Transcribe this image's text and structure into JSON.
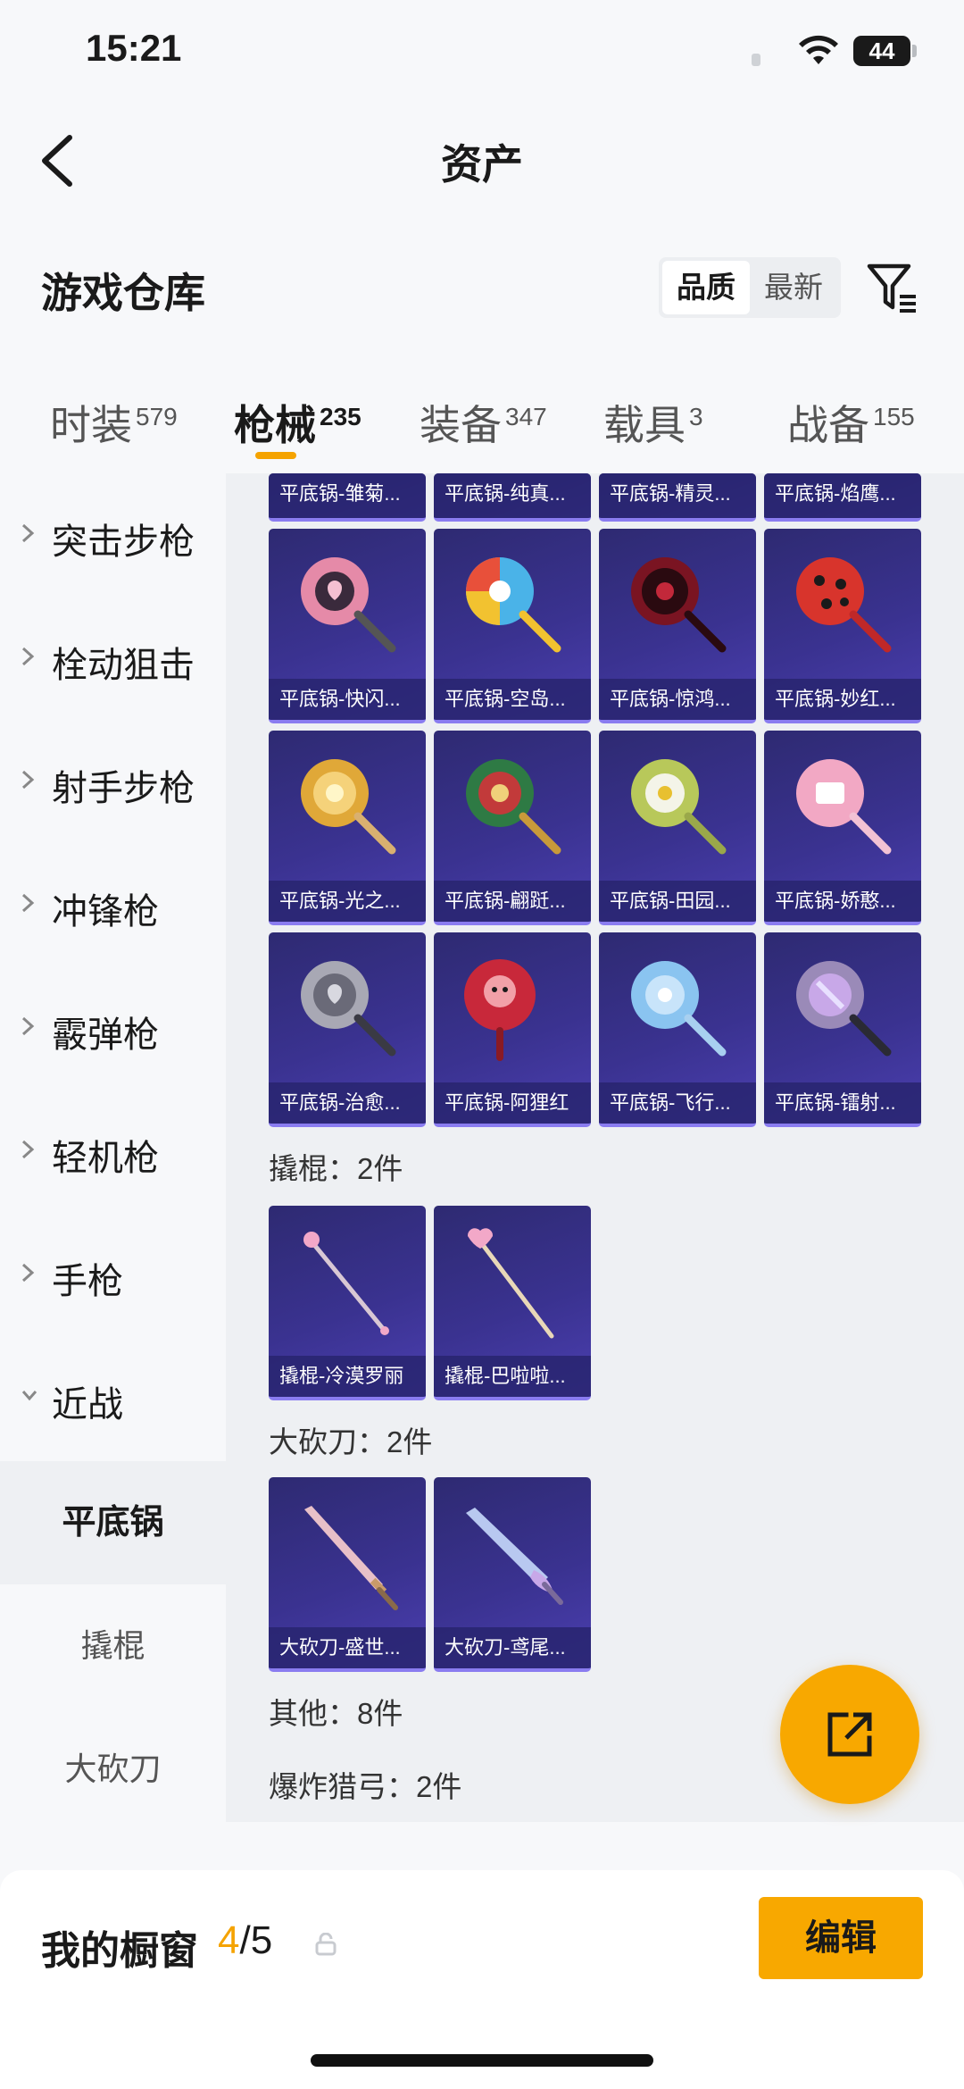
{
  "status": {
    "time": "15:21",
    "battery": "44"
  },
  "nav": {
    "title": "资产"
  },
  "header": {
    "title": "游戏仓库",
    "sort_options": [
      "品质",
      "最新"
    ]
  },
  "tabs": [
    {
      "label": "时装",
      "count": "579"
    },
    {
      "label": "枪械",
      "count": "235"
    },
    {
      "label": "装备",
      "count": "347"
    },
    {
      "label": "载具",
      "count": "3"
    },
    {
      "label": "战备",
      "count": "155"
    }
  ],
  "sidebar": {
    "categories": [
      "突击步枪",
      "栓动狙击",
      "射手步枪",
      "冲锋枪",
      "霰弹枪",
      "轻机枪",
      "手枪",
      "近战"
    ],
    "sub_items": [
      "平底锅",
      "撬棍",
      "大砍刀"
    ]
  },
  "content": {
    "top_row": [
      "平底锅-雏菊...",
      "平底锅-纯真...",
      "平底锅-精灵...",
      "平底锅-焰鹰..."
    ],
    "pans": [
      "平底锅-快闪...",
      "平底锅-空岛...",
      "平底锅-惊鸿...",
      "平底锅-妙红...",
      "平底锅-光之...",
      "平底锅-翩跹...",
      "平底锅-田园...",
      "平底锅-娇憨...",
      "平底锅-治愈...",
      "平底锅-阿狸红",
      "平底锅-飞行...",
      "平底锅-镭射..."
    ],
    "crowbar_heading": "撬棍：2件",
    "crowbars": [
      "撬棍-冷漠罗丽",
      "撬棍-巴啦啦..."
    ],
    "machete_heading": "大砍刀：2件",
    "machetes": [
      "大砍刀-盛世...",
      "大砍刀-鸢尾..."
    ],
    "other_heading": "其他：8件",
    "crossbow_heading": "爆炸猎弓：2件"
  },
  "bottom": {
    "showcase_label": "我的橱窗",
    "showcase_current": "4",
    "showcase_total": "/5",
    "edit_label": "编辑"
  },
  "icons": [
    "back-icon",
    "filter-icon",
    "chevron-right-icon",
    "chevron-down-icon",
    "share-icon",
    "lock-icon",
    "wifi-icon"
  ],
  "colors": {
    "accent": "#f8a800",
    "card": "#3a3290"
  }
}
